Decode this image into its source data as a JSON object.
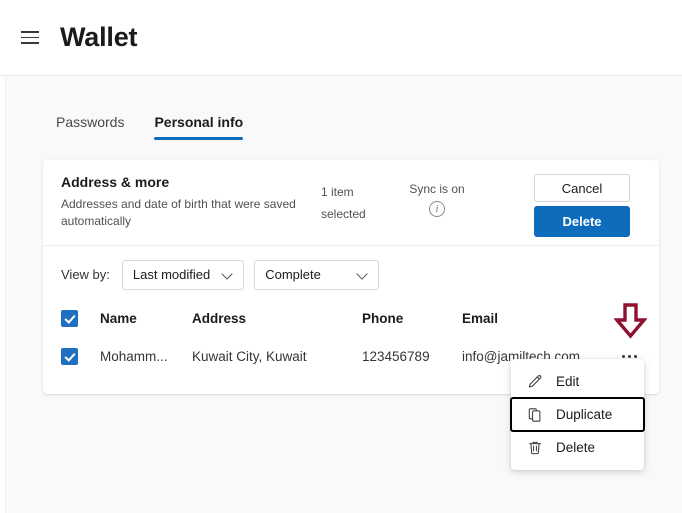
{
  "window": {
    "title": "Wallet",
    "menu_icon": "hamburger-icon"
  },
  "tabs": [
    {
      "label": "Passwords",
      "active": false
    },
    {
      "label": "Personal info",
      "active": true
    }
  ],
  "card": {
    "title": "Address & more",
    "subtitle": "Addresses and date of birth that were saved automatically",
    "selected_count": "1 item selected",
    "sync_label": "Sync is on",
    "info_icon": "info-icon",
    "buttons": {
      "cancel": "Cancel",
      "delete": "Delete"
    }
  },
  "filters": {
    "label": "View by:",
    "sort": {
      "value": "Last modified",
      "chevron": "chevron-down-icon"
    },
    "completeness": {
      "value": "Complete",
      "chevron": "chevron-down-icon"
    }
  },
  "table": {
    "columns": [
      "Name",
      "Address",
      "Phone",
      "Email"
    ],
    "rows": [
      {
        "checked": true,
        "name": "Mohamm...",
        "address": "Kuwait City, Kuwait",
        "phone": "123456789",
        "email": "info@jamiltech.com",
        "more_icon": "ellipsis-icon"
      }
    ],
    "header_checked": true
  },
  "context_menu": {
    "items": [
      {
        "label": "Edit",
        "icon": "pencil-icon",
        "highlighted": false
      },
      {
        "label": "Duplicate",
        "icon": "duplicate-icon",
        "highlighted": true
      },
      {
        "label": "Delete",
        "icon": "trash-icon",
        "highlighted": false
      }
    ]
  },
  "annotation": {
    "arrow_icon": "red-down-arrow",
    "color": "#8e1230"
  },
  "colors": {
    "accent": "#0f6cbd",
    "checkbox": "#1f70c1",
    "page_bg": "#f9f9f9",
    "card_bg": "#ffffff",
    "annotation_red": "#8e1230"
  }
}
